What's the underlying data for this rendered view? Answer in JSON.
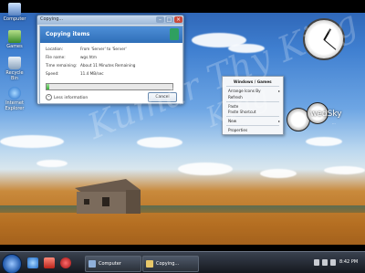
{
  "desktop": {
    "icons": [
      {
        "label": "Computer"
      },
      {
        "label": "Games"
      },
      {
        "label": "Recycle Bin"
      },
      {
        "label": "Internet Explorer"
      }
    ]
  },
  "copy_dialog": {
    "window_title": "Copying...",
    "heading": "Copying items",
    "rows": [
      {
        "label": "Location:",
        "value": "From 'Server' to 'Server'"
      },
      {
        "label": "File name:",
        "value": "wgs.htm"
      },
      {
        "label": "Time remaining:",
        "value": "About 11 Minutes Remaining"
      },
      {
        "label": "Speed:",
        "value": "11.4 MB/sec"
      }
    ],
    "progress": 0.02,
    "less_info": "Less information",
    "cancel": "Cancel"
  },
  "context_menu": {
    "title": "Windows / Games",
    "items": [
      "Arrange Icons By",
      "Refresh",
      "Paste",
      "Paste Shortcut",
      "New",
      "Properties"
    ]
  },
  "gadgets": {
    "brand_text": "wedSky",
    "brand_sub": "..."
  },
  "watermark": {
    "line1": "Kumar Thy King",
    "line2": "King"
  },
  "taskbar": {
    "buttons": [
      {
        "label": "Computer"
      },
      {
        "label": "Copying..."
      }
    ],
    "time": "8:42 PM"
  },
  "colors": {
    "accent": "#2f6fb8",
    "progress": "#3cb13a"
  }
}
